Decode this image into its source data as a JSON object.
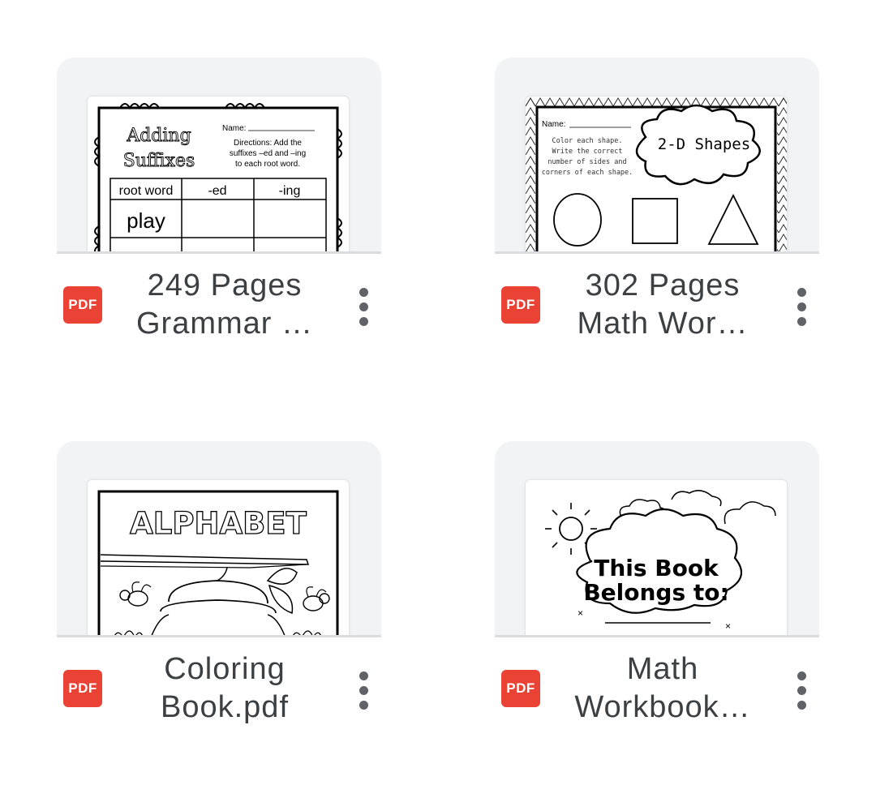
{
  "files": [
    {
      "title_line1": "249 Pages",
      "title_line2": "Grammar …",
      "type_badge": "PDF",
      "thumbnail": {
        "heading1": "Adding",
        "heading2": "Suffixes",
        "name_label": "Name:",
        "directions1": "Directions: Add the",
        "directions2": "suffixes –ed and –ing",
        "directions3": "to each root word.",
        "col1": "root word",
        "col2": "-ed",
        "col3": "-ing",
        "row1": "play"
      }
    },
    {
      "title_line1": "302 Pages",
      "title_line2": "Math Wor…",
      "type_badge": "PDF",
      "thumbnail": {
        "name_label": "Name:",
        "instr1": "Color each shape.",
        "instr2": "Write the correct",
        "instr3": "number of sides and",
        "instr4": "corners of each shape.",
        "cloud_title": "2-D Shapes"
      }
    },
    {
      "title_line1": "Coloring",
      "title_line2": "Book.pdf",
      "type_badge": "PDF",
      "thumbnail": {
        "heading": "ALPHABET"
      }
    },
    {
      "title_line1": "Math",
      "title_line2": "Workbook…",
      "type_badge": "PDF",
      "thumbnail": {
        "line1": "This Book",
        "line2": "Belongs to:"
      }
    }
  ]
}
